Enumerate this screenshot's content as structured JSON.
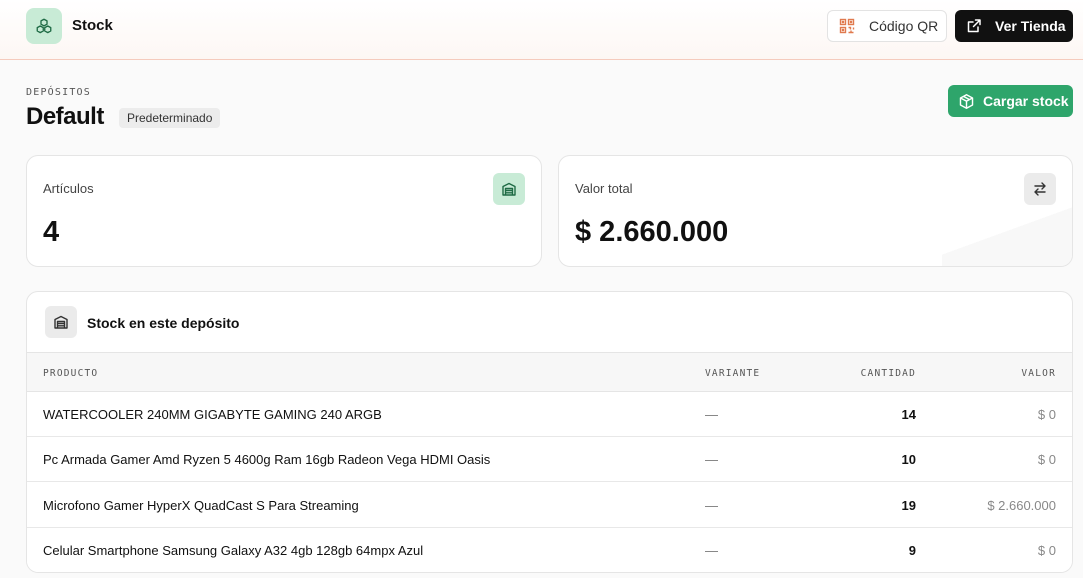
{
  "header": {
    "title": "Stock",
    "qr_label": "Código QR",
    "store_label": "Ver Tienda"
  },
  "page": {
    "eyebrow": "DEPÓSITOS",
    "title": "Default",
    "badge": "Predeterminado",
    "load_button": "Cargar stock"
  },
  "stats": [
    {
      "label": "Artículos",
      "value": "4",
      "icon": "warehouse-icon"
    },
    {
      "label": "Valor total",
      "value": "$ 2.660.000",
      "icon": "swap-arrows-icon"
    }
  ],
  "table": {
    "title": "Stock en este depósito",
    "columns": {
      "product": "PRODUCTO",
      "variant": "VARIANTE",
      "quantity": "CANTIDAD",
      "value": "VALOR"
    },
    "rows": [
      {
        "product": "WATERCOOLER 240MM GIGABYTE GAMING 240 ARGB",
        "variant": "—",
        "quantity": "14",
        "value": "$ 0"
      },
      {
        "product": "Pc Armada Gamer Amd Ryzen 5 4600g Ram 16gb Radeon Vega HDMI Oasis",
        "variant": "—",
        "quantity": "10",
        "value": "$ 0"
      },
      {
        "product": "Microfono Gamer HyperX QuadCast S Para Streaming",
        "variant": "—",
        "quantity": "19",
        "value": "$ 2.660.000"
      },
      {
        "product": "Celular Smartphone Samsung Galaxy A32 4gb 128gb 64mpx Azul",
        "variant": "—",
        "quantity": "9",
        "value": "$ 0"
      }
    ]
  },
  "colors": {
    "accent_green": "#2ea56b",
    "badge_green": "#c8ebd6",
    "header_border": "#f5cbbd",
    "qr_icon": "#e07a4f"
  }
}
